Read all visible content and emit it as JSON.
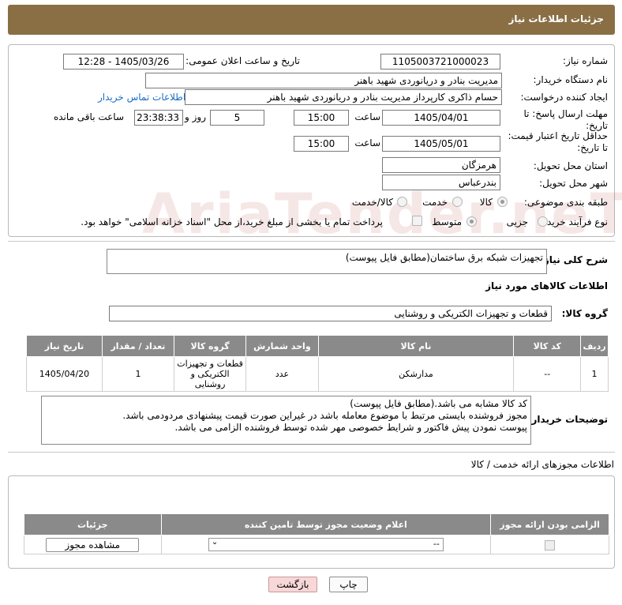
{
  "header": {
    "title": "جزئیات اطلاعات نیاز"
  },
  "fields": {
    "need_number_label": "شماره نیاز:",
    "need_number": "1105003721000023",
    "announce_label": "تاریخ و ساعت اعلان عمومی:",
    "announce_value": "1405/03/26 - 12:28",
    "buyer_org_label": "نام دستگاه خریدار:",
    "buyer_org": "مدیریت بنادر و دریانوردی شهید باهنر",
    "requester_label": "ایجاد کننده درخواست:",
    "requester": "حسام  ذاکری کارپرداز مدیریت بنادر و دریانوردی شهید باهنر",
    "contact_link": "اطلاعات تماس خریدار",
    "deadline_label": "مهلت ارسال پاسخ: تا تاریخ:",
    "deadline_date": "1405/04/01",
    "time_label": "ساعت",
    "deadline_time": "15:00",
    "days_value": "5",
    "days_label": "روز و",
    "remaining_time": "23:38:33",
    "remaining_label": "ساعت باقی مانده",
    "validity_label": "حداقل تاریخ اعتبار قیمت: تا تاریخ:",
    "validity_date": "1405/05/01",
    "validity_time": "15:00",
    "province_label": "استان محل تحویل:",
    "province": "هرمزگان",
    "city_label": "شهر محل تحویل:",
    "city": "بندرعباس",
    "category_label": "طبقه بندی موضوعی:",
    "category_options": [
      "کالا",
      "خدمت",
      "کالا/خدمت"
    ],
    "process_label": "نوع فرآیند خرید :",
    "process_options": [
      "جزیی",
      "متوسط"
    ],
    "payment_note": "پرداخت تمام یا بخشی از مبلغ خرید،از محل \"اسناد خزانه اسلامی\" خواهد بود."
  },
  "description": {
    "label": "شرح کلی نیاز:",
    "value": "تجهیزات شبکه برق ساختمان(مطابق فایل پیوست)"
  },
  "goods": {
    "section_title": "اطلاعات کالاهای مورد نیاز",
    "group_label": "گروه کالا:",
    "group_value": "قطعات و تجهیزات الکتریکی و روشنایی",
    "columns": [
      "ردیف",
      "کد کالا",
      "نام کالا",
      "واحد شمارش",
      "گروه کالا",
      "تعداد / مقدار",
      "تاریخ نیاز"
    ],
    "rows": [
      {
        "row": "1",
        "code": "--",
        "name": "مدارشکن",
        "unit": "عدد",
        "group": "قطعات و تجهیزات الکتریکی و روشنایی",
        "qty": "1",
        "date": "1405/04/20"
      }
    ]
  },
  "buyer_notes": {
    "label": "توضیحات خریدار:",
    "lines": [
      "کد کالا مشابه می باشد.(مطابق فایل پیوست)",
      "مجوز فروشنده بایستی مرتبط با موضوع معامله باشد در غیراین صورت قیمت پیشنهادی مردودمی باشد.",
      "پیوست نمودن پیش فاکتور و شرایط خصوصی مهر شده توسط فروشنده الزامی می باشد."
    ]
  },
  "permits": {
    "title": "اطلاعات مجوزهای ارائه خدمت / کالا",
    "columns": [
      "الزامی بودن ارائه مجوز",
      "اعلام وضعیت مجوز توسط تامین کننده",
      "جزئیات"
    ],
    "select_value": "--",
    "view_button": "مشاهده مجوز"
  },
  "buttons": {
    "print": "چاپ",
    "back": "بازگشت"
  },
  "watermark": "AriaTender.neT"
}
